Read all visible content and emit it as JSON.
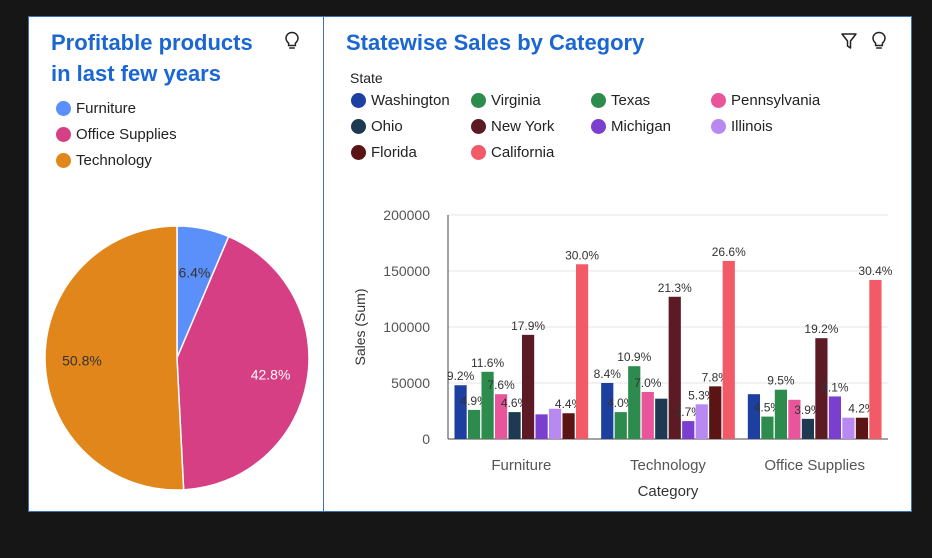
{
  "left_panel": {
    "title": "Profitable products in last few years"
  },
  "right_panel": {
    "title": "Statewise Sales by Category",
    "legend_title": "State"
  },
  "icons": {
    "insight": "lightbulb-icon",
    "filter": "filter-icon"
  },
  "chart_data": [
    {
      "type": "pie",
      "legend": [
        {
          "name": "Furniture",
          "color": "#5b8ff9"
        },
        {
          "name": "Office Supplies",
          "color": "#d63f84"
        },
        {
          "name": "Technology",
          "color": "#e0861a"
        }
      ],
      "slices": [
        {
          "name": "Furniture",
          "value": 6.4,
          "label": "6.4%",
          "color": "#5b8ff9"
        },
        {
          "name": "Office Supplies",
          "value": 42.8,
          "label": "42.8%",
          "color": "#d63f84"
        },
        {
          "name": "Technology",
          "value": 50.8,
          "label": "50.8%",
          "color": "#e0861a"
        }
      ]
    },
    {
      "type": "bar",
      "title": "Statewise Sales by Category",
      "legend_title": "State",
      "xlabel": "Category",
      "ylabel": "Sales (Sum)",
      "ylim": [
        0,
        200000
      ],
      "yticks": [
        "0",
        "50000",
        "100000",
        "150000",
        "200000"
      ],
      "categories": [
        "Furniture",
        "Technology",
        "Office Supplies"
      ],
      "series": [
        {
          "name": "Washington",
          "color": "#1c3fa0",
          "values": [
            48000,
            50000,
            40000
          ],
          "labels": [
            "9.2%",
            "8.4%",
            ""
          ]
        },
        {
          "name": "Virginia",
          "color": "#2e8b4e",
          "values": [
            26000,
            24000,
            20000
          ],
          "labels": [
            "4.9%",
            "4.0%",
            "4.5%"
          ]
        },
        {
          "name": "Texas",
          "color": "#2e8b4e",
          "values": [
            60000,
            65000,
            44000
          ],
          "labels": [
            "11.6%",
            "10.9%",
            "9.5%"
          ]
        },
        {
          "name": "Pennsylvania",
          "color": "#e8559a",
          "values": [
            40000,
            42000,
            35000
          ],
          "labels": [
            "7.6%",
            "7.0%",
            ""
          ]
        },
        {
          "name": "Ohio",
          "color": "#1e3a52",
          "values": [
            24000,
            36000,
            18000
          ],
          "labels": [
            "4.6%",
            "",
            "3.9%"
          ]
        },
        {
          "name": "New York",
          "color": "#5c1a24",
          "values": [
            93000,
            127000,
            90000
          ],
          "labels": [
            "17.9%",
            "21.3%",
            "19.2%"
          ]
        },
        {
          "name": "Michigan",
          "color": "#7b3fd0",
          "values": [
            22000,
            16000,
            38000
          ],
          "labels": [
            "",
            "2.7%",
            "8.1%"
          ]
        },
        {
          "name": "Illinois",
          "color": "#b889f0",
          "values": [
            27000,
            31000,
            19000
          ],
          "labels": [
            "",
            "5.3%",
            ""
          ]
        },
        {
          "name": "Florida",
          "color": "#5a1414",
          "values": [
            23000,
            47000,
            19000
          ],
          "labels": [
            "4.4%",
            "7.8%",
            "4.2%"
          ]
        },
        {
          "name": "California",
          "color": "#f25a68",
          "values": [
            156000,
            159000,
            142000
          ],
          "labels": [
            "30.0%",
            "26.6%",
            "30.4%"
          ]
        }
      ]
    }
  ]
}
